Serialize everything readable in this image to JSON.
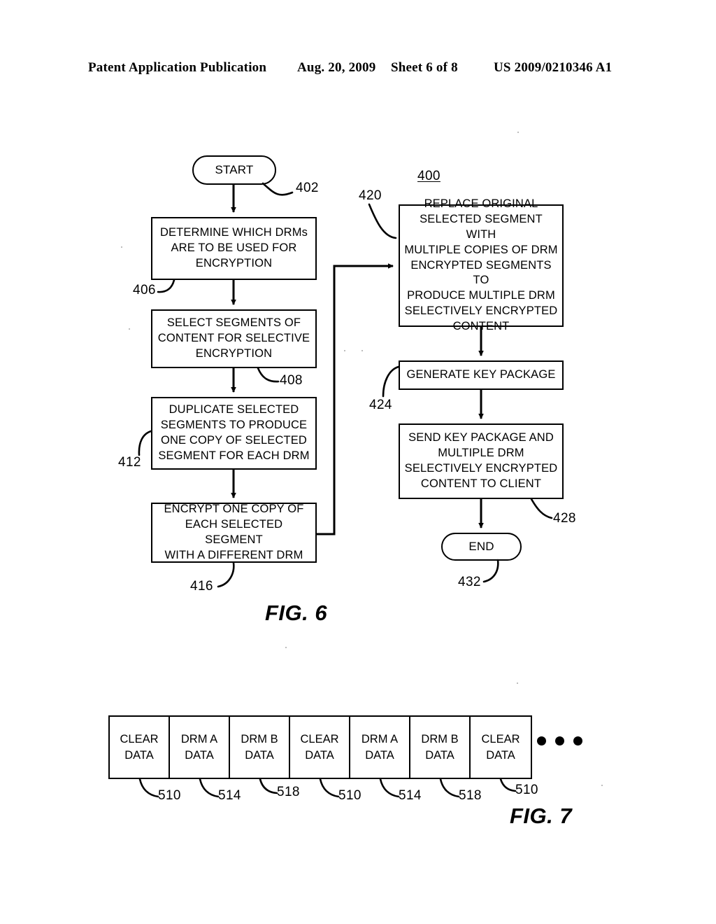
{
  "header": {
    "publication": "Patent Application Publication",
    "date": "Aug. 20, 2009",
    "sheet": "Sheet 6 of 8",
    "patent_number": "US 2009/0210346 A1"
  },
  "figures": [
    {
      "caption": "FIG. 6",
      "diagram_label": "400",
      "nodes": [
        {
          "id": "402",
          "ref": "402",
          "shape": "terminal",
          "text": "START"
        },
        {
          "id": "406",
          "ref": "406",
          "shape": "process",
          "text": "DETERMINE WHICH DRMs\nARE TO BE USED FOR\nENCRYPTION"
        },
        {
          "id": "408",
          "ref": "408",
          "shape": "process",
          "text": "SELECT SEGMENTS OF\nCONTENT FOR SELECTIVE\nENCRYPTION"
        },
        {
          "id": "412",
          "ref": "412",
          "shape": "process",
          "text": "DUPLICATE SELECTED\nSEGMENTS TO PRODUCE\nONE COPY OF SELECTED\nSEGMENT FOR EACH DRM"
        },
        {
          "id": "416",
          "ref": "416",
          "shape": "process",
          "text": "ENCRYPT ONE COPY OF\nEACH SELECTED SEGMENT\nWITH A DIFFERENT DRM"
        },
        {
          "id": "420",
          "ref": "420",
          "shape": "process",
          "text": "REPLACE ORIGINAL\nSELECTED SEGMENT WITH\nMULTIPLE COPIES OF DRM\nENCRYPTED SEGMENTS TO\nPRODUCE MULTIPLE DRM\nSELECTIVELY ENCRYPTED\nCONTENT"
        },
        {
          "id": "424",
          "ref": "424",
          "shape": "process",
          "text": "GENERATE KEY PACKAGE"
        },
        {
          "id": "428",
          "ref": "428",
          "shape": "process",
          "text": "SEND KEY PACKAGE AND\nMULTIPLE DRM\nSELECTIVELY ENCRYPTED\nCONTENT TO CLIENT"
        },
        {
          "id": "432",
          "ref": "432",
          "shape": "terminal",
          "text": "END"
        }
      ]
    },
    {
      "caption": "FIG. 7",
      "segments": [
        {
          "label": "CLEAR\nDATA",
          "ref": "510"
        },
        {
          "label": "DRM A\nDATA",
          "ref": "514"
        },
        {
          "label": "DRM B\nDATA",
          "ref": "518"
        },
        {
          "label": "CLEAR\nDATA",
          "ref": "510"
        },
        {
          "label": "DRM A\nDATA",
          "ref": "514"
        },
        {
          "label": "DRM B\nDATA",
          "ref": "518"
        },
        {
          "label": "CLEAR\nDATA",
          "ref": "510"
        }
      ],
      "continuation": "•••"
    }
  ],
  "colors": {
    "ink": "#000000",
    "paper": "#ffffff"
  }
}
